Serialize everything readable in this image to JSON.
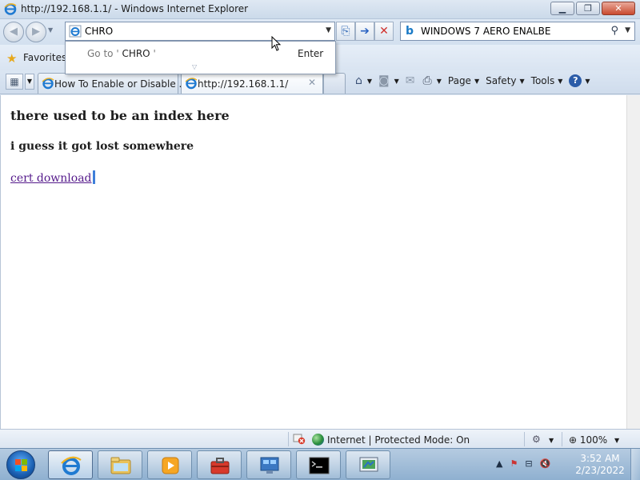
{
  "window": {
    "title": "http://192.168.1.1/ - Windows Internet Explorer",
    "minimize_glyph": "▁",
    "restore_glyph": "❐",
    "close_glyph": "✕"
  },
  "navigation": {
    "back_glyph": "◀",
    "forward_glyph": "▶",
    "address_value": "CHRO",
    "compat_glyph": "⎘",
    "go_glyph": "➔",
    "stop_glyph": "✕"
  },
  "search": {
    "provider_glyph": "b",
    "value": "WINDOWS 7 AERO ENALBE",
    "search_glyph": "⚲"
  },
  "autocomplete": {
    "goto_prefix": "Go to '",
    "goto_value": " CHRO ",
    "goto_suffix": "'",
    "enter_label": "Enter"
  },
  "favorites": {
    "label": "Favorites"
  },
  "tabs": [
    {
      "label": "How To Enable or Disable ...",
      "active": false
    },
    {
      "label": "http://192.168.1.1/",
      "active": true,
      "close_glyph": "✕"
    }
  ],
  "command_bar": {
    "page_label": "Page",
    "safety_label": "Safety",
    "tools_label": "Tools",
    "help_glyph": "?"
  },
  "page": {
    "heading": "there used to be an index here",
    "subheading": "i guess it got lost somewhere",
    "link_text": "cert download"
  },
  "status": {
    "zone_text": "Internet | Protected Mode: On",
    "zoom": "100%"
  },
  "taskbar": {
    "clock_time": "3:52 AM",
    "clock_date": "2/23/2022"
  },
  "colors": {
    "link_visited": "#551a8b",
    "accent": "#2b5ca8"
  }
}
